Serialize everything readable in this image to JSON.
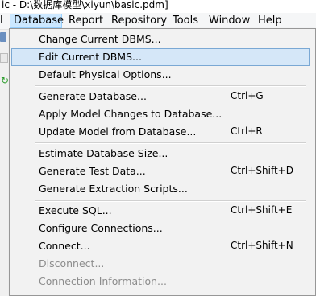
{
  "window": {
    "title": "ic - D:\\数据库模型\\xiyun\\basic.pdm]"
  },
  "menubar": {
    "items": [
      {
        "label": "l"
      },
      {
        "label": "Database"
      },
      {
        "label": "Report"
      },
      {
        "label": "Repository"
      },
      {
        "label": "Tools"
      },
      {
        "label": "Window"
      },
      {
        "label": "Help"
      }
    ]
  },
  "database_menu": {
    "groups": [
      [
        {
          "label": "Change Current DBMS...",
          "shortcut": "",
          "enabled": true
        },
        {
          "label": "Edit Current DBMS...",
          "shortcut": "",
          "enabled": true,
          "highlighted": true
        },
        {
          "label": "Default Physical Options...",
          "shortcut": "",
          "enabled": true
        }
      ],
      [
        {
          "label": "Generate Database...",
          "shortcut": "Ctrl+G",
          "enabled": true
        },
        {
          "label": "Apply Model Changes to Database...",
          "shortcut": "",
          "enabled": true
        },
        {
          "label": "Update Model from Database...",
          "shortcut": "Ctrl+R",
          "enabled": true
        }
      ],
      [
        {
          "label": "Estimate Database Size...",
          "shortcut": "",
          "enabled": true
        },
        {
          "label": "Generate Test Data...",
          "shortcut": "Ctrl+Shift+D",
          "enabled": true
        },
        {
          "label": "Generate Extraction Scripts...",
          "shortcut": "",
          "enabled": true
        }
      ],
      [
        {
          "label": "Execute SQL...",
          "shortcut": "Ctrl+Shift+E",
          "enabled": true
        },
        {
          "label": "Configure Connections...",
          "shortcut": "",
          "enabled": true
        },
        {
          "label": "Connect...",
          "shortcut": "Ctrl+Shift+N",
          "enabled": true
        },
        {
          "label": "Disconnect...",
          "shortcut": "",
          "enabled": false
        },
        {
          "label": "Connection Information...",
          "shortcut": "",
          "enabled": false
        }
      ]
    ]
  }
}
